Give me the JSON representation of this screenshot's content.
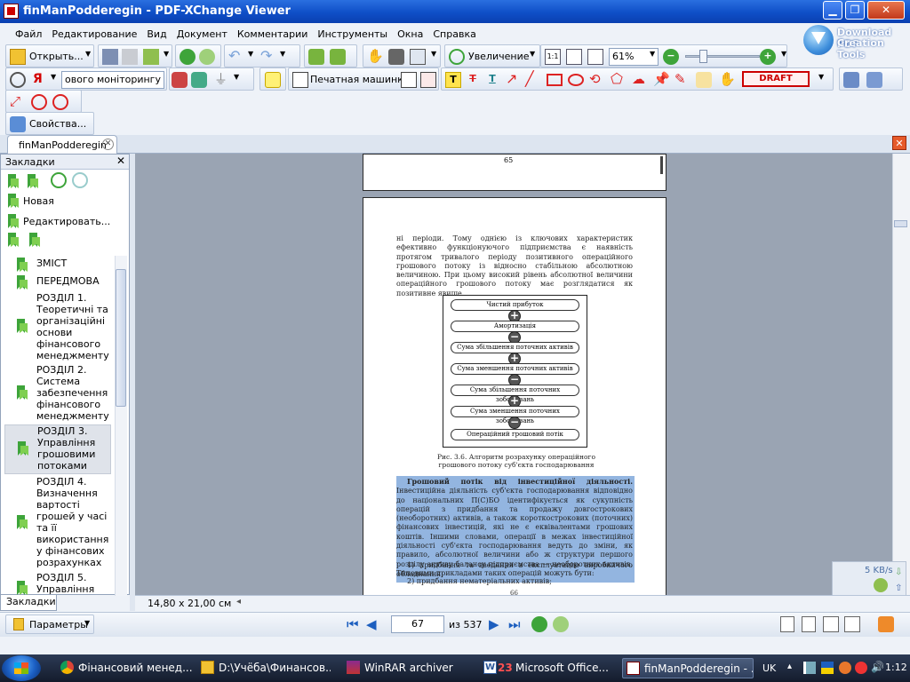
{
  "window": {
    "title": "finManPodderegin - PDF-XChange Viewer"
  },
  "menu": [
    "Файл",
    "Редактирование",
    "Вид",
    "Документ",
    "Комментарии",
    "Инструменты",
    "Окна",
    "Справка"
  ],
  "download": {
    "line1": "Download PDF",
    "line2": "Creation Tools"
  },
  "toolbar1": {
    "open_label": "Открыть...",
    "zoom_in_label": "Увеличение",
    "zoom_value": "61%"
  },
  "toolbar2": {
    "search_text": "ового моніторингу",
    "typewriter_label": "Печатная машинка",
    "stamp_label": "DRAFT"
  },
  "toolbar4": {
    "properties_label": "Свойства..."
  },
  "tab": {
    "label": "finManPodderegin"
  },
  "sidebar": {
    "title": "Закладки",
    "new_label": "Новая",
    "edit_label": "Редактировать...",
    "tab_label": "Закладки",
    "items": [
      {
        "label": "ЗМІСТ"
      },
      {
        "label": "ПЕРЕДМОВА"
      },
      {
        "label": "РОЗДІЛ 1. Теоретичні та організаційні основи фінансового менеджменту"
      },
      {
        "label": "РОЗДІЛ 2. Система забезпечення фінансового менеджменту"
      },
      {
        "label": "РОЗДІЛ 3. Управління грошовими потоками"
      },
      {
        "label": "РОЗДІЛ 4. Визначення вартості грошей у часі та її використання у фінансових розрахунках"
      },
      {
        "label": "РОЗДІЛ 5. Управління"
      }
    ]
  },
  "document": {
    "prev_page_number": "65",
    "para1": "ні періоди. Тому однією із ключових характеристик ефективно функціонуючого підприємства є наявність протягом тривалого періоду позитивного операційного грошового потоку із відносно стабільною абсолютною величиною. При цьому високий рівень абсолютної величини операційного грошового потоку має розглядатися як позитивне явище.",
    "flow_items": [
      "Чистий прибуток",
      "Амортизація",
      "Сума збільшення поточних активів",
      "Сума зменшення поточних активів",
      "Сума збільшення поточних зобов'язань",
      "Сума зменшення поточних зобов'язань",
      "Операційний грошовий потік"
    ],
    "flow_ops": [
      "+",
      "−",
      "+",
      "−",
      "+",
      "−"
    ],
    "caption": "Рис. 3.6. Алгоритм розрахунку операційного грошового потоку суб'єкта господарювання",
    "heading": "Грошовий потік від інвестиційної діяльності.",
    "para2": "Інвестиційна діяльність суб'єкта господарювання відповідно до національних П(С)БО ідентифікується як сукупність операцій з придбання та продажу довгострокових (необоротних) активів, а також короткострокових (поточних) фінансових інвестицій, які не є еквівалентами грошових коштів. Іншими словами, операції в межах інвестиційної діяльності суб'єкта господарювання ведуть до зміни, як правило, абсолютної величини або ж структури першого розділу активу балансу підприємства — необоротних активів. Типовими прикладами таких операцій можуть бути:",
    "item1": "1) придбання та введення в експлуатацію виробничого обладнання;",
    "item2": "2) придбання нематеріальних активів;",
    "next_page_number": "66"
  },
  "status": {
    "page_size": "14,80 x 21,00 см",
    "net_speed": "5 KB/s"
  },
  "nav": {
    "params_label": "Параметры",
    "page_current": "67",
    "page_of": "из 537"
  },
  "taskbar": {
    "items": [
      {
        "label": "Фінансовий менед..."
      },
      {
        "label": "D:\\Учёба\\Финансов..."
      },
      {
        "label": "WinRAR archiver"
      },
      {
        "label": "Microsoft Office..."
      },
      {
        "label": "finManPodderegin - ..."
      }
    ],
    "word_badge": "23",
    "lang": "UK",
    "clock": "1:12"
  }
}
